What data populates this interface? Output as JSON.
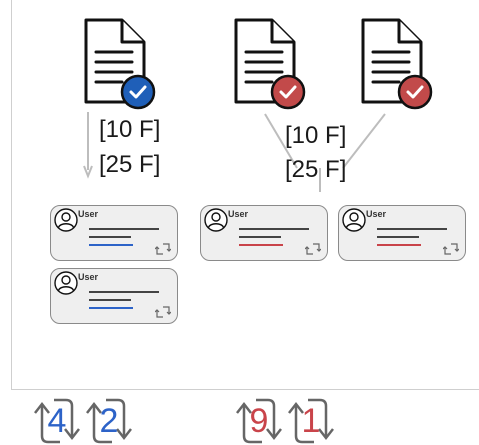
{
  "colors": {
    "blue_accent": "#2d63c8",
    "red_accent": "#c9444a",
    "doc_badge_blue": "#1f5fb8",
    "doc_badge_red": "#c24a4a",
    "panel_border": "#cfcfcf",
    "card_bg": "#efefef"
  },
  "left_group": {
    "doc_icon": "document-check-icon",
    "labels": [
      "[10 F]",
      "[25 F]"
    ],
    "cards": [
      {
        "user": "User",
        "accent": "blue"
      },
      {
        "user": "User",
        "accent": "blue"
      }
    ],
    "counts": [
      "4",
      "2"
    ]
  },
  "right_group": {
    "doc_icons": [
      "document-check-icon",
      "document-check-icon"
    ],
    "labels": [
      "[10 F]",
      "[25 F]"
    ],
    "cards": [
      {
        "user": "User",
        "accent": "red"
      },
      {
        "user": "User",
        "accent": "red"
      }
    ],
    "counts": [
      "9",
      "1"
    ]
  }
}
